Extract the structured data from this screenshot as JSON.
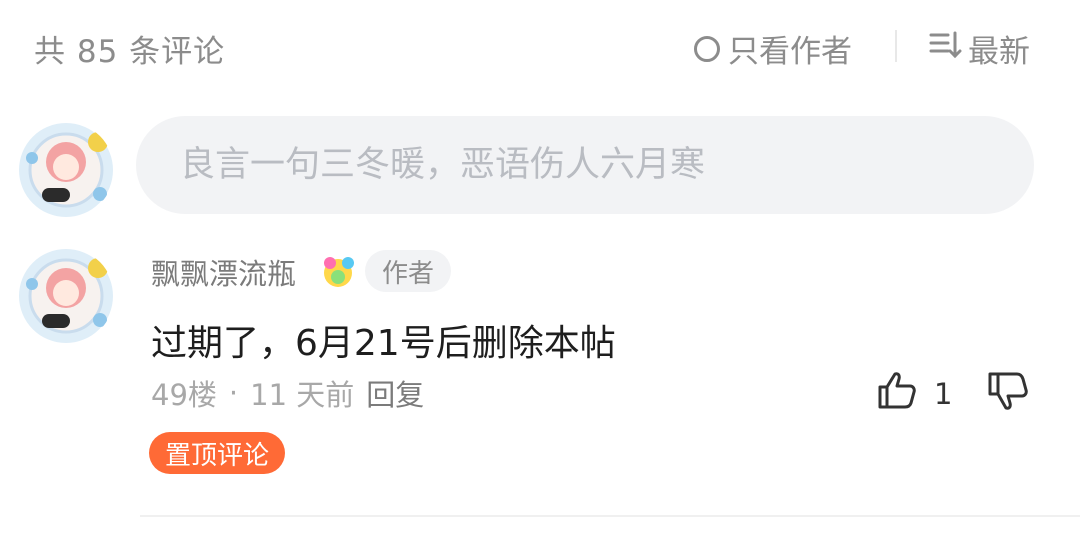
{
  "header": {
    "comment_count": "共 85 条评论",
    "author_only_label": "只看作者",
    "sort_label": "最新"
  },
  "composer": {
    "placeholder": "良言一句三冬暖，恶语伤人六月寒"
  },
  "comment": {
    "username": "飘飘漂流瓶",
    "author_tag": "作者",
    "text": "过期了，6月21号后删除本帖",
    "floor": "49楼",
    "dot": "·",
    "time": "11 天前",
    "reply_label": "回复",
    "likes": "1",
    "pinned_label": "置顶评论"
  },
  "colors": {
    "accent": "#ff6a36",
    "muted_text": "#8c8c8c",
    "input_bg": "#f2f3f5"
  },
  "icons": [
    "circle-icon",
    "sort-icon",
    "thumbs-up-icon",
    "thumbs-down-icon",
    "badge-icon"
  ]
}
